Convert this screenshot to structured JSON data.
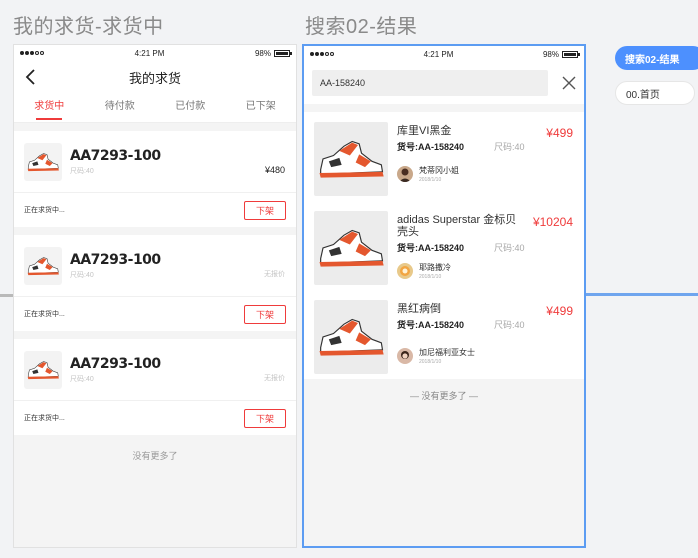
{
  "artboards": {
    "left_title": "我的求货-求货中",
    "right_title": "搜索02-结果"
  },
  "statusbar": {
    "time": "4:21 PM",
    "battery": "98%"
  },
  "my_requests": {
    "nav_title": "我的求货",
    "tabs": [
      {
        "label": "求货中",
        "active": true
      },
      {
        "label": "待付款",
        "active": false
      },
      {
        "label": "已付款",
        "active": false
      },
      {
        "label": "已下架",
        "active": false
      }
    ],
    "cards": [
      {
        "code": "AA7293-100",
        "size": "尺码:40",
        "price": "¥480",
        "status": "正在求货中...",
        "action": "下架"
      },
      {
        "code": "AA7293-100",
        "size": "尺码:40",
        "price": "无报价",
        "status": "正在求货中...",
        "action": "下架"
      },
      {
        "code": "AA7293-100",
        "size": "尺码:40",
        "price": "无报价",
        "status": "正在求货中...",
        "action": "下架"
      }
    ],
    "no_more": "没有更多了"
  },
  "search_results": {
    "query": "AA-158240",
    "items": [
      {
        "name": "库里VI黑金",
        "code": "货号:AA-158240",
        "size": "尺码:40",
        "price": "¥499",
        "seller": "梵蒂冈小姐",
        "date": "2018/1/10"
      },
      {
        "name": "adidas Superstar 金标贝壳头",
        "code": "货号:AA-158240",
        "size": "尺码:40",
        "price": "¥10204",
        "seller": "耶路撒冷",
        "date": "2018/1/10"
      },
      {
        "name": "黑红病倒",
        "code": "货号:AA-158240",
        "size": "尺码:40",
        "price": "¥499",
        "seller": "加尼福利亚女士",
        "date": "2018/1/10"
      }
    ],
    "no_more": "—   没有更多了   —"
  },
  "side_nav": {
    "current": "搜索02-结果",
    "home": "00.首页"
  },
  "colors": {
    "accent_red": "#ef3b3b",
    "selection_blue": "#5c9cf2",
    "nav_blue": "#4d90fe"
  }
}
